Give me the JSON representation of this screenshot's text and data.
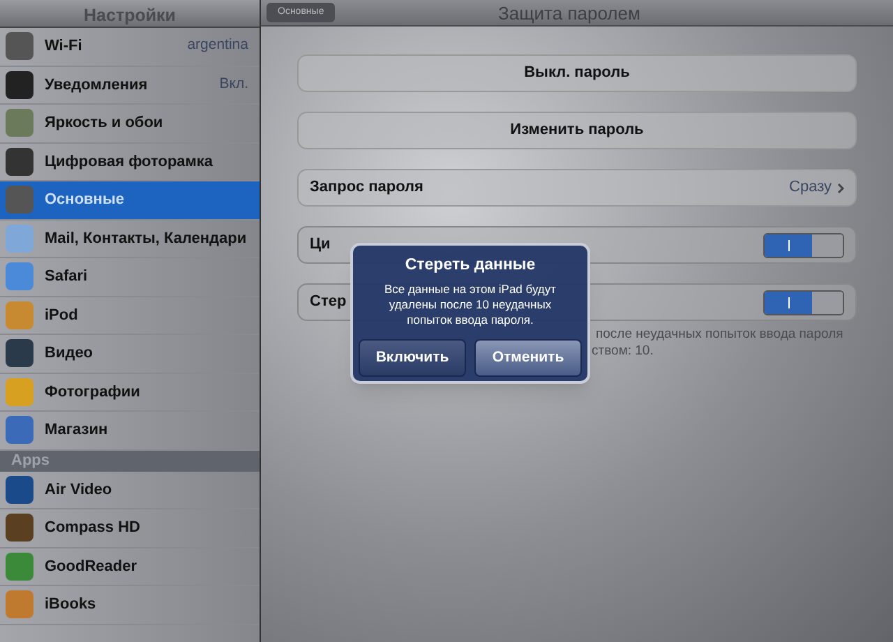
{
  "sidebar": {
    "title": "Настройки",
    "items": [
      {
        "label": "Wi-Fi",
        "value": "argentina",
        "selected": false
      },
      {
        "label": "Уведомления",
        "value": "Вкл.",
        "selected": false
      },
      {
        "label": "Яркость и обои",
        "selected": false
      },
      {
        "label": "Цифровая фоторамка",
        "selected": false
      },
      {
        "label": "Основные",
        "selected": true
      },
      {
        "label": "Mail, Контакты, Календари",
        "selected": false
      },
      {
        "label": "Safari",
        "selected": false
      },
      {
        "label": "iPod",
        "selected": false
      },
      {
        "label": "Видео",
        "selected": false
      },
      {
        "label": "Фотографии",
        "selected": false
      },
      {
        "label": "Магазин",
        "selected": false
      }
    ],
    "section": "Apps",
    "apps": [
      {
        "label": "Air Video",
        "selected": false
      },
      {
        "label": "Compass HD",
        "selected": false
      },
      {
        "label": "GoodReader",
        "selected": false
      },
      {
        "label": "iBooks",
        "selected": false
      }
    ]
  },
  "header": {
    "back": "Основные",
    "title": "Защита паролем"
  },
  "buttons": [
    "Выкл. пароль",
    "Изменить пароль"
  ],
  "request_row": {
    "label": "Запрос пароля",
    "value": "Сразу"
  },
  "toggles": [
    {
      "label": "Ци",
      "on": true
    },
    {
      "label": "Стер",
      "on": true
    }
  ],
  "footer_lines": [
    "после неудачных попыток ввода пароля",
    "ством: 10."
  ],
  "alert": {
    "title": "Стереть данные",
    "message": "Все данные на этом iPad будут удалены после 10 неудачных попыток ввода пароля.",
    "buttons": [
      "Включить",
      "Отменить"
    ]
  }
}
